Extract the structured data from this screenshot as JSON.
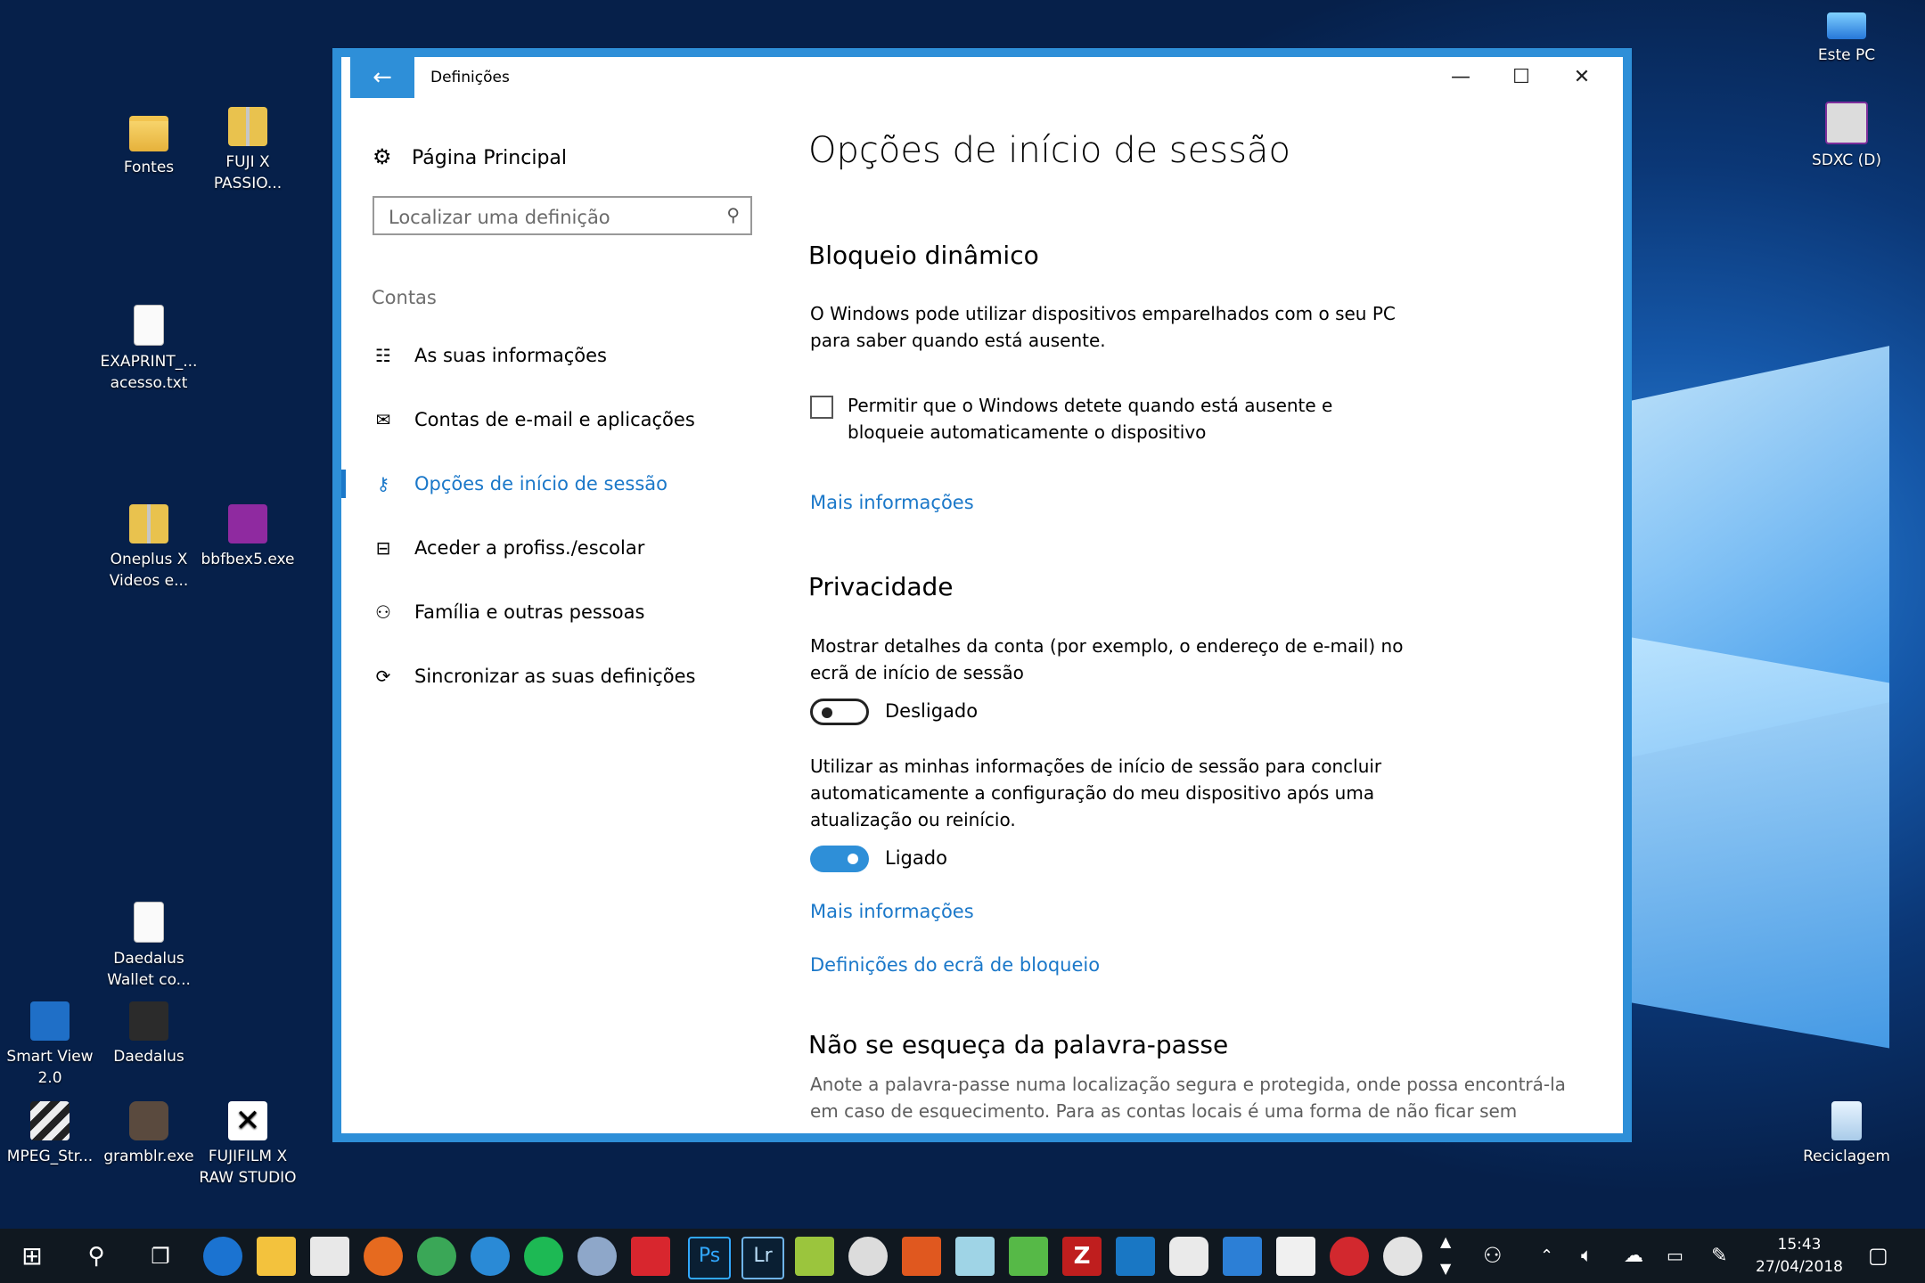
{
  "desktop": {
    "icons": [
      {
        "label": "Fontes",
        "icon": "folder-icon"
      },
      {
        "label": "FUJI X PASSIO...",
        "icon": "zip-folder-icon"
      },
      {
        "label": "EXAPRINT_... acesso.txt",
        "icon": "text-file-icon"
      },
      {
        "label": "Oneplus X Videos e...",
        "icon": "zip-folder-icon"
      },
      {
        "label": "bbfbex5.exe",
        "icon": "app-icon"
      },
      {
        "label": "Daedalus Wallet co...",
        "icon": "text-file-icon"
      },
      {
        "label": "Smart View 2.0",
        "icon": "app-icon"
      },
      {
        "label": "Daedalus",
        "icon": "app-icon"
      },
      {
        "label": "MPEG_Str...",
        "icon": "clapperboard-icon"
      },
      {
        "label": "gramblr.exe",
        "icon": "camera-app-icon"
      },
      {
        "label": "FUJIFILM X RAW STUDIO",
        "icon": "x-logo-icon"
      },
      {
        "label": "Este PC",
        "icon": "computer-icon"
      },
      {
        "label": "SDXC (D)",
        "icon": "sd-card-icon"
      },
      {
        "label": "Reciclagem",
        "icon": "recycle-bin-icon"
      }
    ]
  },
  "window": {
    "title": "Definições",
    "back_glyph": "←",
    "minimize_glyph": "—",
    "maximize_glyph": "☐",
    "close_glyph": "✕",
    "accent": "#2e8fd8"
  },
  "sidebar": {
    "home_label": "Página Principal",
    "search_placeholder": "Localizar uma definição",
    "section": "Contas",
    "items": [
      {
        "label": "As suas informações",
        "icon": "user-card-icon",
        "glyph": "☷"
      },
      {
        "label": "Contas de e-mail e aplicações",
        "icon": "mail-icon",
        "glyph": "✉"
      },
      {
        "label": "Opções de início de sessão",
        "icon": "key-icon",
        "glyph": "⚷"
      },
      {
        "label": "Aceder a profiss./escolar",
        "icon": "briefcase-icon",
        "glyph": "⊟"
      },
      {
        "label": "Família e outras pessoas",
        "icon": "person-add-icon",
        "glyph": "⚇"
      },
      {
        "label": "Sincronizar as suas definições",
        "icon": "sync-icon",
        "glyph": "⟳"
      }
    ],
    "active_index": 2
  },
  "content": {
    "page_title": "Opções de início de sessão",
    "dynamic_lock": {
      "heading": "Bloqueio dinâmico",
      "description": "O Windows pode utilizar dispositivos emparelhados com o seu PC para saber quando está ausente.",
      "checkbox_label": "Permitir que o Windows detete quando está ausente e bloqueie automaticamente o dispositivo",
      "checkbox_checked": false,
      "more_info": "Mais informações"
    },
    "privacy": {
      "heading": "Privacidade",
      "show_details_text": "Mostrar detalhes da conta (por exemplo, o endereço de e-mail) no ecrã de início de sessão",
      "show_details_state": "Desligado",
      "use_signin_text": "Utilizar as minhas informações de início de sessão para concluir automaticamente a configuração do meu dispositivo após uma atualização ou reinício.",
      "use_signin_state": "Ligado",
      "more_info": "Mais informações",
      "lock_screen_link": "Definições do ecrã de bloqueio"
    },
    "password": {
      "heading": "Não se esqueça da palavra-passe",
      "description": "Anote a palavra-passe numa localização segura e protegida, onde possa encontrá-la em caso de esquecimento. Para as contas locais é uma forma de não ficar sem acesso"
    }
  },
  "taskbar": {
    "start_icon": "windows-start-icon",
    "apps": [
      "search-icon",
      "task-view-icon",
      "edge-icon",
      "file-explorer-icon",
      "store-icon",
      "firefox-icon",
      "chrome-icon",
      "thunderbird-icon",
      "spotify-icon",
      "app-icon",
      "creative-cloud-icon",
      "photoshop-icon",
      "lightroom-icon",
      "app-icon",
      "app-icon",
      "pdf-icon",
      "app-icon",
      "app-icon",
      "filezilla-icon",
      "app-icon",
      "onedrive-icon",
      "app-icon",
      "mail-icon",
      "app-icon",
      "ccleaner-icon"
    ],
    "photoshop_label": "Ps",
    "lightroom_label": "Lr",
    "filezilla_label": "Z",
    "time": "15:43",
    "date": "27/04/2018"
  }
}
